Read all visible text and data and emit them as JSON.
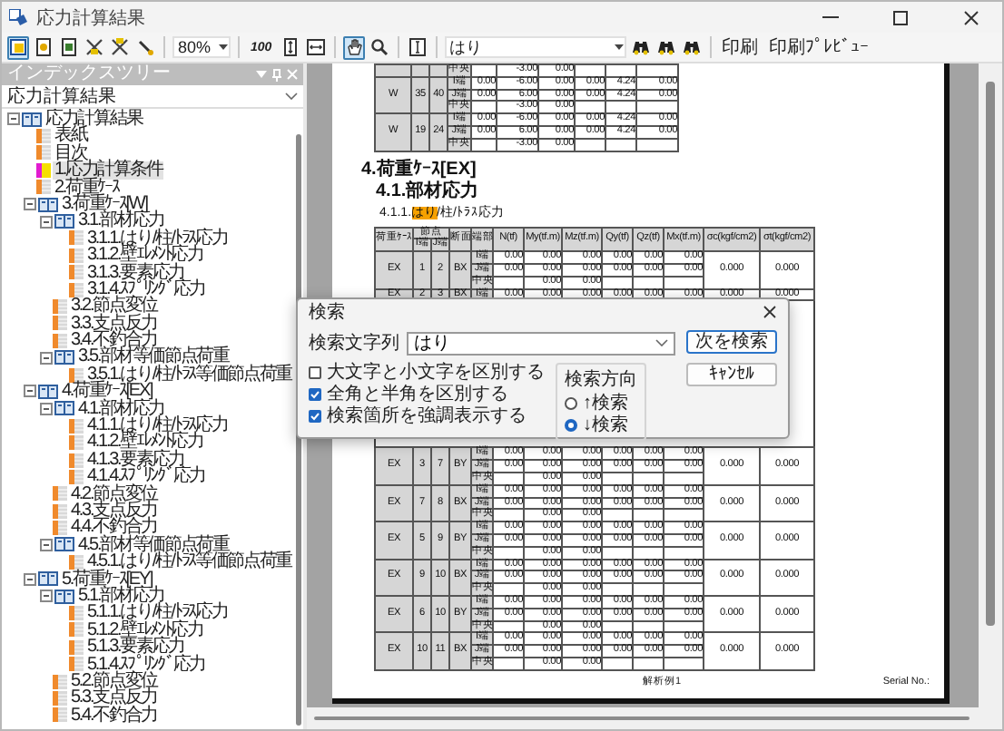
{
  "window": {
    "title": "応力計算結果"
  },
  "toolbar": [
    {
      "kind": "icon",
      "pressed": true
    },
    {
      "kind": "icon",
      "pressed": false
    },
    {
      "kind": "icon",
      "pressed": false
    },
    {
      "kind": "icon",
      "pressed": false
    },
    {
      "kind": "icon",
      "pressed": false
    },
    {
      "kind": "icon",
      "pressed": false
    },
    {
      "kind": "combo",
      "value": "80%"
    },
    {
      "kind": "label",
      "label": "100"
    },
    {
      "kind": "icon",
      "pressed": false
    },
    {
      "kind": "icon",
      "pressed": false
    },
    {
      "kind": "icon",
      "pressed": true
    },
    {
      "kind": "icon",
      "pressed": false
    },
    {
      "kind": "icon",
      "pressed": false
    },
    {
      "kind": "search",
      "value": "はり"
    },
    {
      "kind": "icon",
      "pressed": false
    },
    {
      "kind": "icon",
      "pressed": false
    },
    {
      "kind": "icon",
      "pressed": false
    },
    {
      "kind": "text_button",
      "label": "印刷"
    },
    {
      "kind": "text_button",
      "label": "印刷ﾌﾟﾚﾋﾞｭｰ"
    }
  ],
  "index_panel": {
    "title": "インデックスツリー",
    "selector": "応力計算結果",
    "tree": [
      {
        "label": "応力計算結果",
        "kind": "folder",
        "selected": false,
        "expanded": true,
        "children": [
          {
            "label": "表紙",
            "kind": "page",
            "selected": false
          },
          {
            "label": "目次",
            "kind": "page",
            "selected": false
          },
          {
            "label": "1.応力計算条件",
            "kind": "page",
            "selected": true
          },
          {
            "label": "2.荷重ｹｰｽ",
            "kind": "page",
            "selected": false
          },
          {
            "label": "3.荷重ｹｰｽ[W]",
            "kind": "folder",
            "selected": false,
            "expanded": true,
            "children": [
              {
                "label": "3.1.部材応力",
                "kind": "folder",
                "selected": false,
                "expanded": true,
                "children": [
                  {
                    "label": "3.1.1.はり/柱/ﾄﾗｽ応力",
                    "kind": "page",
                    "selected": false
                  },
                  {
                    "label": "3.1.2.壁ｴﾚﾒﾝﾄ応力",
                    "kind": "page",
                    "selected": false
                  },
                  {
                    "label": "3.1.3.要素応力",
                    "kind": "page",
                    "selected": false
                  },
                  {
                    "label": "3.1.4.ｽﾌﾟﾘﾝｸﾞ応力",
                    "kind": "page",
                    "selected": false
                  }
                ]
              },
              {
                "label": "3.2.節点変位",
                "kind": "page",
                "selected": false
              },
              {
                "label": "3.3.支点反力",
                "kind": "page",
                "selected": false
              },
              {
                "label": "3.4.不釣合力",
                "kind": "page",
                "selected": false
              },
              {
                "label": "3.5.部材等価節点荷重",
                "kind": "folder",
                "selected": false,
                "expanded": true,
                "children": [
                  {
                    "label": "3.5.1.はり/柱/ﾄﾗｽ等価節点荷重",
                    "kind": "page",
                    "selected": false
                  }
                ]
              }
            ]
          },
          {
            "label": "4.荷重ｹｰｽ[EX]",
            "kind": "folder",
            "selected": false,
            "expanded": true,
            "children": [
              {
                "label": "4.1.部材応力",
                "kind": "folder",
                "selected": false,
                "expanded": true,
                "children": [
                  {
                    "label": "4.1.1.はり/柱/ﾄﾗｽ応力",
                    "kind": "page",
                    "selected": false
                  },
                  {
                    "label": "4.1.2.壁ｴﾚﾒﾝﾄ応力",
                    "kind": "page",
                    "selected": false
                  },
                  {
                    "label": "4.1.3.要素応力",
                    "kind": "page",
                    "selected": false
                  },
                  {
                    "label": "4.1.4.ｽﾌﾟﾘﾝｸﾞ応力",
                    "kind": "page",
                    "selected": false
                  }
                ]
              },
              {
                "label": "4.2.節点変位",
                "kind": "page",
                "selected": false
              },
              {
                "label": "4.3.支点反力",
                "kind": "page",
                "selected": false
              },
              {
                "label": "4.4.不釣合力",
                "kind": "page",
                "selected": false
              },
              {
                "label": "4.5.部材等価節点荷重",
                "kind": "folder",
                "selected": false,
                "expanded": true,
                "children": [
                  {
                    "label": "4.5.1.はり/柱/ﾄﾗｽ等価節点荷重",
                    "kind": "page",
                    "selected": false
                  }
                ]
              }
            ]
          },
          {
            "label": "5.荷重ｹｰｽ[EY]",
            "kind": "folder",
            "selected": false,
            "expanded": true,
            "children": [
              {
                "label": "5.1.部材応力",
                "kind": "folder",
                "selected": false,
                "expanded": true,
                "children": [
                  {
                    "label": "5.1.1.はり/柱/ﾄﾗｽ応力",
                    "kind": "page",
                    "selected": false
                  },
                  {
                    "label": "5.1.2.壁ｴﾚﾒﾝﾄ応力",
                    "kind": "page",
                    "selected": false
                  },
                  {
                    "label": "5.1.3.要素応力",
                    "kind": "page",
                    "selected": false
                  },
                  {
                    "label": "5.1.4.ｽﾌﾟﾘﾝｸﾞ応力",
                    "kind": "page",
                    "selected": false
                  }
                ]
              },
              {
                "label": "5.2.節点変位",
                "kind": "page",
                "selected": false
              },
              {
                "label": "5.3.支点反力",
                "kind": "page",
                "selected": false
              },
              {
                "label": "5.4.不釣合力",
                "kind": "page",
                "selected": false
              }
            ]
          }
        ]
      }
    ]
  },
  "document": {
    "top_table": {
      "rows": [
        {
          "lines": [
            {
              "end": "中央",
              "column_6": "-3.00",
              "column_7": "0.00"
            }
          ]
        },
        {
          "label": "W",
          "i": "35",
          "j": "40",
          "lines": [
            {
              "end": "I端",
              "column_5": "0.00",
              "column_6": "-6.00",
              "column_7": "0.00",
              "column_8": "0.00",
              "column_9": "4.24",
              "column_10": "0.00"
            },
            {
              "end": "J端",
              "column_5": "0.00",
              "column_6": "6.00",
              "column_7": "0.00",
              "column_8": "0.00",
              "column_9": "4.24",
              "column_10": "0.00"
            },
            {
              "end": "中央",
              "column_6": "-3.00",
              "column_7": "0.00"
            }
          ]
        },
        {
          "label": "W",
          "i": "19",
          "j": "24",
          "lines": [
            {
              "end": "I端",
              "column_5": "0.00",
              "column_6": "-6.00",
              "column_7": "0.00",
              "column_8": "0.00",
              "column_9": "4.24",
              "column_10": "0.00"
            },
            {
              "end": "J端",
              "column_5": "0.00",
              "column_6": "6.00",
              "column_7": "0.00",
              "column_8": "0.00",
              "column_9": "4.24",
              "column_10": "0.00"
            },
            {
              "end": "中央",
              "column_6": "-3.00",
              "column_7": "0.00"
            }
          ]
        }
      ]
    },
    "headings": [
      {
        "kind": "h1",
        "text": "4.荷重ｹｰｽ[EX]"
      },
      {
        "kind": "h2",
        "text": "4.1.部材応力"
      }
    ],
    "caption": [
      {
        "text": "4.1.1.",
        "highlighted": false
      },
      {
        "text": "はり",
        "highlighted": true
      },
      {
        "text": "/柱/ﾄﾗｽ応力",
        "highlighted": false
      }
    ],
    "table": {
      "columns": [
        {
          "label": "荷重ｹｰｽ"
        },
        {
          "label": "節点",
          "sub": [
            "I端",
            "J端"
          ]
        },
        {
          "label": "断面"
        },
        {
          "label": "端部"
        },
        {
          "label": "N(tf)"
        },
        {
          "label": "My(tf.m)"
        },
        {
          "label": "Mz(tf.m)"
        },
        {
          "label": "Qy(tf)"
        },
        {
          "label": "Qz(tf)"
        },
        {
          "label": "Mx(tf.m)"
        },
        {
          "label": "σc(kgf/cm2)"
        },
        {
          "label": "σt(kgf/cm2)"
        }
      ],
      "rows": [
        {
          "case": "EX",
          "i": "1",
          "j": "2",
          "section": "BX",
          "sc": "0.000",
          "st": "0.000",
          "lines": [
            {
              "end": "I端",
              "n": "0.00",
              "my": "0.00",
              "mz": "0.00",
              "qy": "0.00",
              "qz": "0.00",
              "mx": "0.00"
            },
            {
              "end": "J端",
              "n": "0.00",
              "my": "0.00",
              "mz": "0.00",
              "qy": "0.00",
              "qz": "0.00",
              "mx": "0.00"
            },
            {
              "end": "中央",
              "my": "0.00",
              "mz": "0.00"
            }
          ]
        },
        {
          "case": "EX",
          "i": "2",
          "j": "3",
          "section": "BX",
          "sc": "0.000",
          "st": "0.000",
          "lines": [
            {
              "end": "I端",
              "n": "0.00",
              "my": "0.00",
              "mz": "0.00",
              "qy": "0.00",
              "qz": "0.00",
              "mx": "0.00"
            }
          ]
        },
        {
          "case": "EX",
          "i": "3",
          "j": "7",
          "section": "BY",
          "sc": "0.000",
          "st": "0.000",
          "lines": [
            {
              "end": "I端",
              "n": "0.00",
              "my": "0.00",
              "mz": "0.00",
              "qy": "0.00",
              "qz": "0.00",
              "mx": "0.00"
            },
            {
              "end": "J端",
              "n": "0.00",
              "my": "0.00",
              "mz": "0.00",
              "qy": "0.00",
              "qz": "0.00",
              "mx": "0.00"
            },
            {
              "end": "中央",
              "my": "0.00",
              "mz": "0.00"
            }
          ]
        },
        {
          "case": "EX",
          "i": "7",
          "j": "8",
          "section": "BX",
          "sc": "0.000",
          "st": "0.000",
          "lines": [
            {
              "end": "I端",
              "n": "0.00",
              "my": "0.00",
              "mz": "0.00",
              "qy": "0.00",
              "qz": "0.00",
              "mx": "0.00"
            },
            {
              "end": "J端",
              "n": "0.00",
              "my": "0.00",
              "mz": "0.00",
              "qy": "0.00",
              "qz": "0.00",
              "mx": "0.00"
            },
            {
              "end": "中央",
              "my": "0.00",
              "mz": "0.00"
            }
          ]
        },
        {
          "case": "EX",
          "i": "5",
          "j": "9",
          "section": "BY",
          "sc": "0.000",
          "st": "0.000",
          "lines": [
            {
              "end": "I端",
              "n": "0.00",
              "my": "0.00",
              "mz": "0.00",
              "qy": "0.00",
              "qz": "0.00",
              "mx": "0.00"
            },
            {
              "end": "J端",
              "n": "0.00",
              "my": "0.00",
              "mz": "0.00",
              "qy": "0.00",
              "qz": "0.00",
              "mx": "0.00"
            },
            {
              "end": "中央",
              "my": "0.00",
              "mz": "0.00"
            }
          ]
        },
        {
          "case": "EX",
          "i": "9",
          "j": "10",
          "section": "BX",
          "sc": "0.000",
          "st": "0.000",
          "lines": [
            {
              "end": "I端",
              "n": "0.00",
              "my": "0.00",
              "mz": "0.00",
              "qy": "0.00",
              "qz": "0.00",
              "mx": "0.00"
            },
            {
              "end": "J端",
              "n": "0.00",
              "my": "0.00",
              "mz": "0.00",
              "qy": "0.00",
              "qz": "0.00",
              "mx": "0.00"
            },
            {
              "end": "中央",
              "my": "0.00",
              "mz": "0.00"
            }
          ]
        },
        {
          "case": "EX",
          "i": "6",
          "j": "10",
          "section": "BY",
          "sc": "0.000",
          "st": "0.000",
          "lines": [
            {
              "end": "I端",
              "n": "0.00",
              "my": "0.00",
              "mz": "0.00",
              "qy": "0.00",
              "qz": "0.00",
              "mx": "0.00"
            },
            {
              "end": "J端",
              "n": "0.00",
              "my": "0.00",
              "mz": "0.00",
              "qy": "0.00",
              "qz": "0.00",
              "mx": "0.00"
            },
            {
              "end": "中央",
              "my": "0.00",
              "mz": "0.00"
            }
          ]
        },
        {
          "case": "EX",
          "i": "10",
          "j": "11",
          "section": "BX",
          "sc": "0.000",
          "st": "0.000",
          "lines": [
            {
              "end": "I端",
              "n": "0.00",
              "my": "0.00",
              "mz": "0.00",
              "qy": "0.00",
              "qz": "0.00",
              "mx": "0.00"
            },
            {
              "end": "J端",
              "n": "0.00",
              "my": "0.00",
              "mz": "0.00",
              "qy": "0.00",
              "qz": "0.00",
              "mx": "0.00"
            },
            {
              "end": "中央",
              "my": "0.00",
              "mz": "0.00"
            }
          ]
        }
      ]
    },
    "footer": {
      "title": "解析例1",
      "serial": "Serial No.:"
    }
  },
  "find_dialog": {
    "title": "検索",
    "field_label": "検索文字列",
    "value": "はり",
    "options": [
      {
        "label": "大文字と小文字を区別する",
        "checked": false
      },
      {
        "label": "全角と半角を区別する",
        "checked": true
      },
      {
        "label": "検索箇所を強調表示する",
        "checked": true
      }
    ],
    "direction": {
      "label": "検索方向",
      "options": [
        {
          "label": "↑検索",
          "selected": false
        },
        {
          "label": "↓検索",
          "selected": true
        }
      ]
    },
    "buttons": [
      {
        "label": "次を検索",
        "default": true
      },
      {
        "label": "ｷｬﾝｾﾙ",
        "default": false
      }
    ]
  }
}
